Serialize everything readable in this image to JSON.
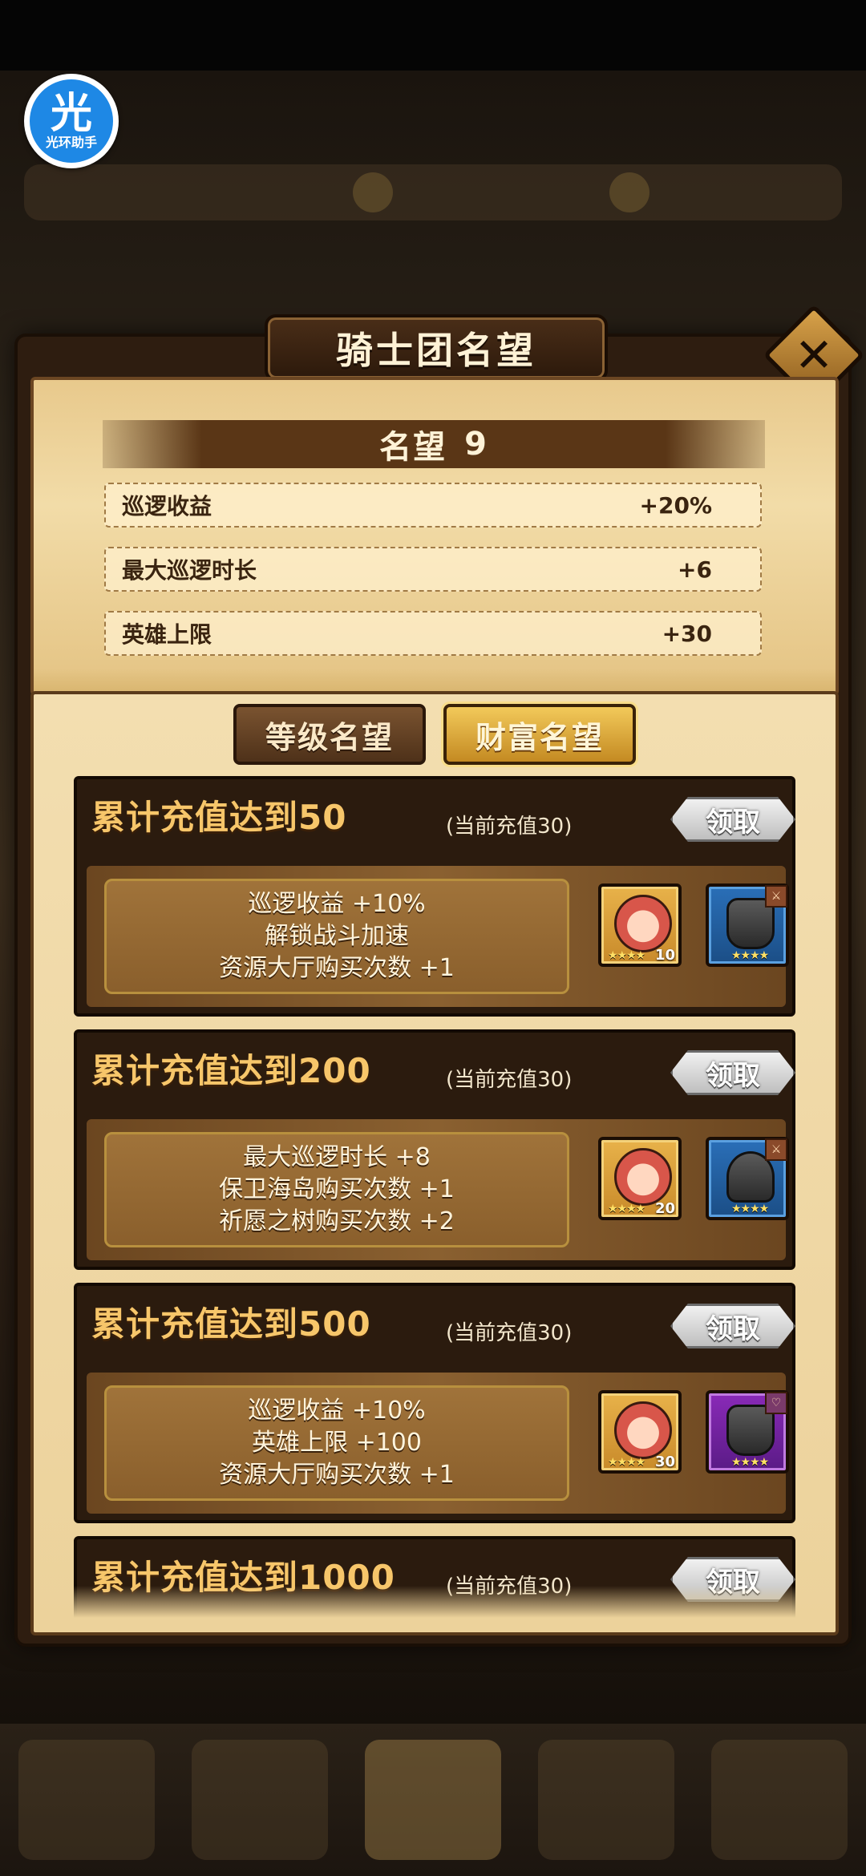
{
  "assistant_badge": {
    "char": "光",
    "label": "光环助手"
  },
  "modal": {
    "title": "骑士团名望",
    "close_icon": "close-x-icon",
    "level_label": "名望",
    "level_value": "9",
    "stats": [
      {
        "label": "巡逻收益",
        "value": "+20%"
      },
      {
        "label": "最大巡逻时长",
        "value": "+6"
      },
      {
        "label": "英雄上限",
        "value": "+30"
      }
    ],
    "tabs": [
      {
        "label": "等级名望",
        "active": false
      },
      {
        "label": "财富名望",
        "active": true
      }
    ],
    "cards": [
      {
        "title": "累计充值达到50",
        "current": "(当前充值30)",
        "button": "领取",
        "rewards": [
          "巡逻收益 +10%",
          "解锁战斗加速",
          "资源大厅购买次数 +1"
        ],
        "hero_count": "10",
        "hero_stars": "★★★★",
        "gear_color": "blue",
        "gear_stars": "★★★★"
      },
      {
        "title": "累计充值达到200",
        "current": "(当前充值30)",
        "button": "领取",
        "rewards": [
          "最大巡逻时长 +8",
          "保卫海岛购买次数 +1",
          "祈愿之树购买次数 +2"
        ],
        "hero_count": "20",
        "hero_stars": "★★★★",
        "gear_color": "blue",
        "gear_stars": "★★★★"
      },
      {
        "title": "累计充值达到500",
        "current": "(当前充值30)",
        "button": "领取",
        "rewards": [
          "巡逻收益 +10%",
          "英雄上限 +100",
          "资源大厅购买次数 +1"
        ],
        "hero_count": "30",
        "hero_stars": "★★★★",
        "gear_color": "purple",
        "gear_stars": "★★★★"
      },
      {
        "title": "累计充值达到1000",
        "current": "(当前充值30)",
        "button": "领取",
        "rewards": [],
        "hero_count": "",
        "hero_stars": "",
        "gear_color": "blue",
        "gear_stars": ""
      }
    ]
  },
  "colors": {
    "title_gold": "#f7c66a",
    "parchment": "#f3deb0",
    "card_dark": "#2b1b0e",
    "badge_blue": "#1e88e5"
  }
}
